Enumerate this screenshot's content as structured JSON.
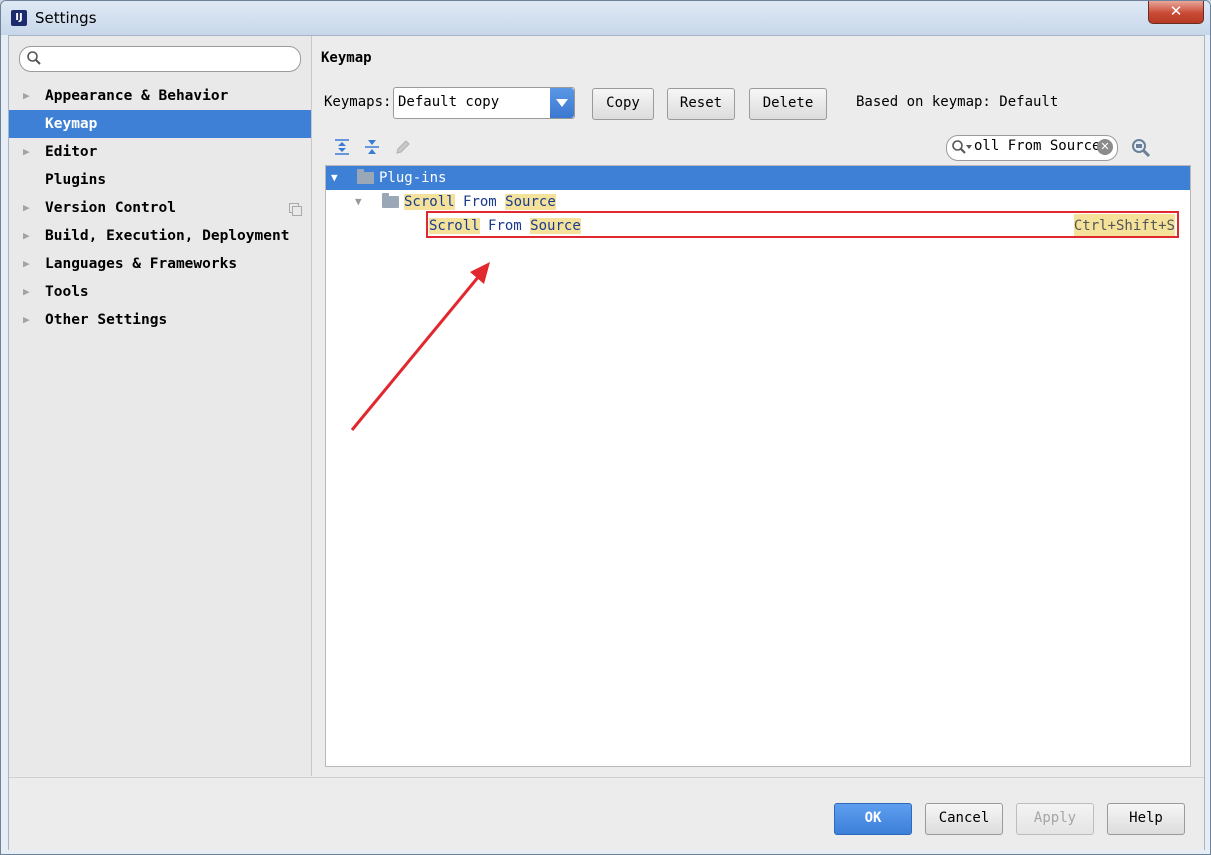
{
  "window": {
    "title": "Settings",
    "close_symbol": "✕",
    "app_icon_letter": "IJ"
  },
  "sidebar": {
    "search": {
      "placeholder": "",
      "value": ""
    },
    "items": [
      {
        "label": "Appearance & Behavior",
        "expandable": true,
        "selected": false
      },
      {
        "label": "Keymap",
        "expandable": false,
        "selected": true
      },
      {
        "label": "Editor",
        "expandable": true,
        "selected": false
      },
      {
        "label": "Plugins",
        "expandable": false,
        "selected": false
      },
      {
        "label": "Version Control",
        "expandable": true,
        "selected": false,
        "copy_icon": true
      },
      {
        "label": "Build, Execution, Deployment",
        "expandable": true,
        "selected": false
      },
      {
        "label": "Languages & Frameworks",
        "expandable": true,
        "selected": false
      },
      {
        "label": "Tools",
        "expandable": true,
        "selected": false
      },
      {
        "label": "Other Settings",
        "expandable": true,
        "selected": false
      }
    ]
  },
  "main": {
    "title": "Keymap",
    "keymaps_label": "Keymaps:",
    "keymap_selected": "Default copy",
    "buttons": {
      "copy": "Copy",
      "reset": "Reset",
      "delete": "Delete"
    },
    "based_on": "Based on keymap: Default",
    "toolbar_icons": [
      "expand-all-icon",
      "collapse-all-icon",
      "edit-pencil-icon"
    ],
    "filter": {
      "value": "oll From Source"
    },
    "tree": {
      "root": "Plug-ins",
      "group": {
        "w1": "Scroll",
        "w2": "From",
        "w3": "Source"
      },
      "action": {
        "w1": "Scroll",
        "w2": "From",
        "w3": "Source",
        "shortcut": "Ctrl+Shift+S"
      }
    }
  },
  "footer": {
    "ok": "OK",
    "cancel": "Cancel",
    "apply": "Apply",
    "help": "Help"
  },
  "colors": {
    "selection": "#3e80d6",
    "highlight": "#f4e29b",
    "annotation": "#e0282e"
  }
}
